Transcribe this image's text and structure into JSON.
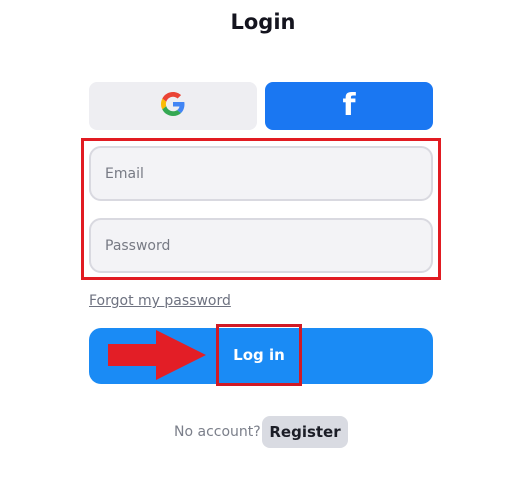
{
  "header": {
    "title": "Login"
  },
  "social": {
    "google": {
      "icon": "google-icon"
    },
    "facebook": {
      "icon": "facebook-icon",
      "glyph": "f",
      "color": "#1a77f2"
    }
  },
  "form": {
    "email": {
      "value": "",
      "placeholder": "Email"
    },
    "password": {
      "value": "",
      "placeholder": "Password"
    },
    "forgot_label": "Forgot my password",
    "login_label": "Log in",
    "login_color": "#1a8bf5"
  },
  "footer": {
    "no_account_text": "No account?",
    "register_label": "Register"
  },
  "annotations": {
    "highlight_color": "#e11b22",
    "arrow_icon": "red-arrow-icon"
  }
}
